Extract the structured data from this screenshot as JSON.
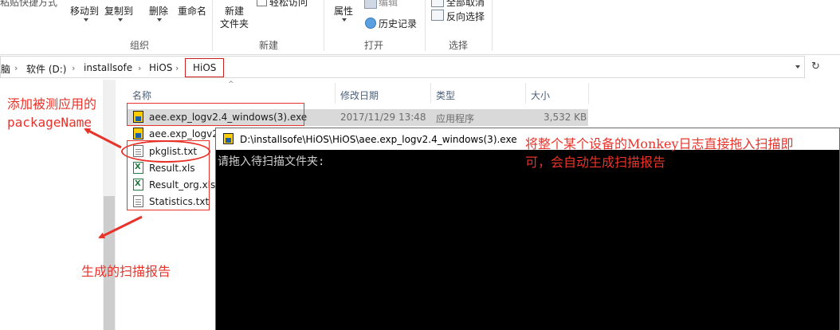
{
  "ribbon": {
    "paste_shortcut_label": "粘贴快捷方式",
    "move_to_label": "移动到",
    "copy_to_label": "复制到",
    "delete_label": "删除",
    "rename_label": "重命名",
    "new_folder_label_1": "新建",
    "new_folder_label_2": "文件夹",
    "easy_access_label": "轻松访问",
    "properties_label": "属性",
    "edit_label": "编辑",
    "history_label": "历史记录",
    "select_none_label": "全部取消",
    "invert_selection_label": "反向选择",
    "groups": {
      "organize": "组织",
      "new": "新建",
      "open": "打开",
      "select": "选择"
    }
  },
  "address": {
    "crumbs": [
      "软件 (D:)",
      "installsofe",
      "HiOS",
      "HiOS"
    ],
    "leading_fragment": "脑"
  },
  "columns": {
    "name": "名称",
    "date": "修改日期",
    "type": "类型",
    "size": "大小"
  },
  "files": [
    {
      "name": "aee.exp_logv2.4_windows(3).exe",
      "date": "2017/11/29 13:48",
      "type": "应用程序",
      "size": "3,532 KB",
      "icon": "exe-icon"
    },
    {
      "name": "aee.exp_logv2",
      "icon": "exe-icon"
    },
    {
      "name": "pkglist.txt",
      "icon": "txt-icon"
    },
    {
      "name": "Result.xls",
      "icon": "xls-icon"
    },
    {
      "name": "Result_org.xls",
      "icon": "xls-icon"
    },
    {
      "name": "Statistics.txt",
      "icon": "txt-icon"
    }
  ],
  "console": {
    "title": "D:\\installsofe\\HiOS\\HiOS\\aee.exp_logv2.4_windows(3).exe",
    "prompt": "请拖入待扫描文件夹:"
  },
  "annotations": {
    "top_left_line1": "添加被测应用的",
    "top_left_line2": "packageName",
    "bottom_left": "生成的扫描报告",
    "right_line1": "将整个某个设备的Monkey日志直接拖入扫描即",
    "right_line2": "可，会自动生成扫描报告",
    "color": "#e8332a"
  }
}
